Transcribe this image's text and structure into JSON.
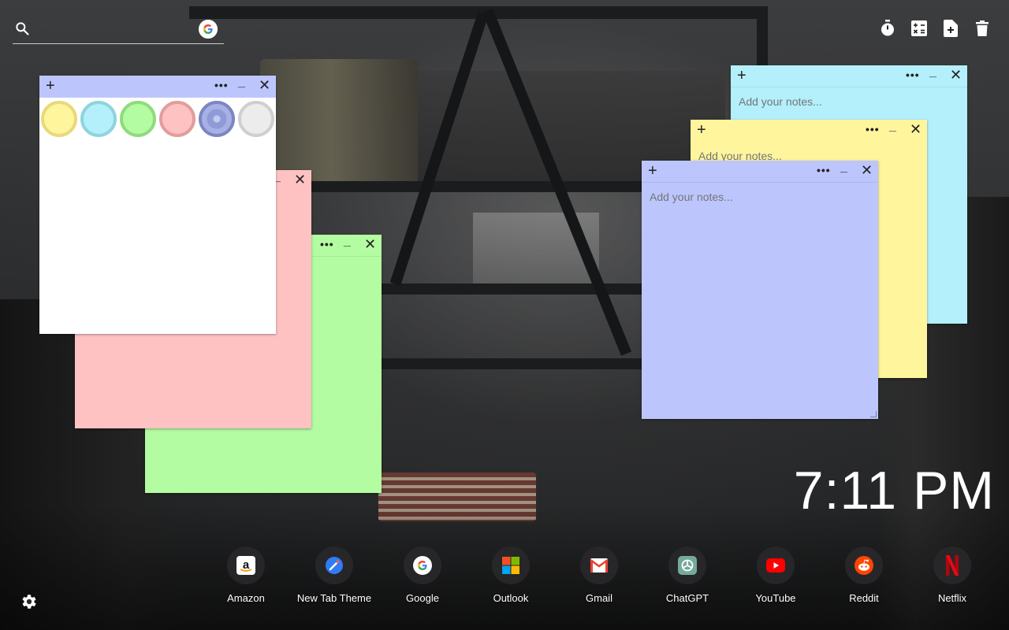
{
  "search": {
    "placeholder": ""
  },
  "toolbar": {
    "items": [
      {
        "icon": "timer-icon"
      },
      {
        "icon": "calculator-icon"
      },
      {
        "icon": "add-note-icon"
      },
      {
        "icon": "trash-icon"
      }
    ]
  },
  "notes": {
    "placeholder": "Add your notes...",
    "buttons": {
      "add": "+",
      "more": "•••",
      "minimize": "_",
      "close": "✕"
    },
    "colors": {
      "yellow": "#fff59d",
      "blue": "#b3f0fb",
      "green": "#b3fca1",
      "pink": "#ffc2c2",
      "purple": "#bcc6fd",
      "white": "#ffffff"
    }
  },
  "swatches": [
    {
      "name": "yellow",
      "fill": "#fff59d",
      "ring": "#e8d97a"
    },
    {
      "name": "blue",
      "fill": "#b3f0fb",
      "ring": "#8fd3de"
    },
    {
      "name": "green",
      "fill": "#b3fca1",
      "ring": "#8fdb7e"
    },
    {
      "name": "pink",
      "fill": "#ffc2c2",
      "ring": "#e39c9c"
    },
    {
      "name": "purple",
      "fill": "#8f9ad6",
      "ring": "#7b86c2"
    },
    {
      "name": "gray",
      "fill": "#ececec",
      "ring": "#cfcfcf"
    }
  ],
  "clock": {
    "time": "7:11 PM"
  },
  "shortcuts": [
    {
      "label": "Amazon",
      "icon": "amazon-icon"
    },
    {
      "label": "New Tab Theme",
      "icon": "new-tab-theme-icon"
    },
    {
      "label": "Google",
      "icon": "google-icon"
    },
    {
      "label": "Outlook",
      "icon": "outlook-icon"
    },
    {
      "label": "Gmail",
      "icon": "gmail-icon"
    },
    {
      "label": "ChatGPT",
      "icon": "chatgpt-icon"
    },
    {
      "label": "YouTube",
      "icon": "youtube-icon"
    },
    {
      "label": "Reddit",
      "icon": "reddit-icon"
    },
    {
      "label": "Netflix",
      "icon": "netflix-icon"
    }
  ]
}
